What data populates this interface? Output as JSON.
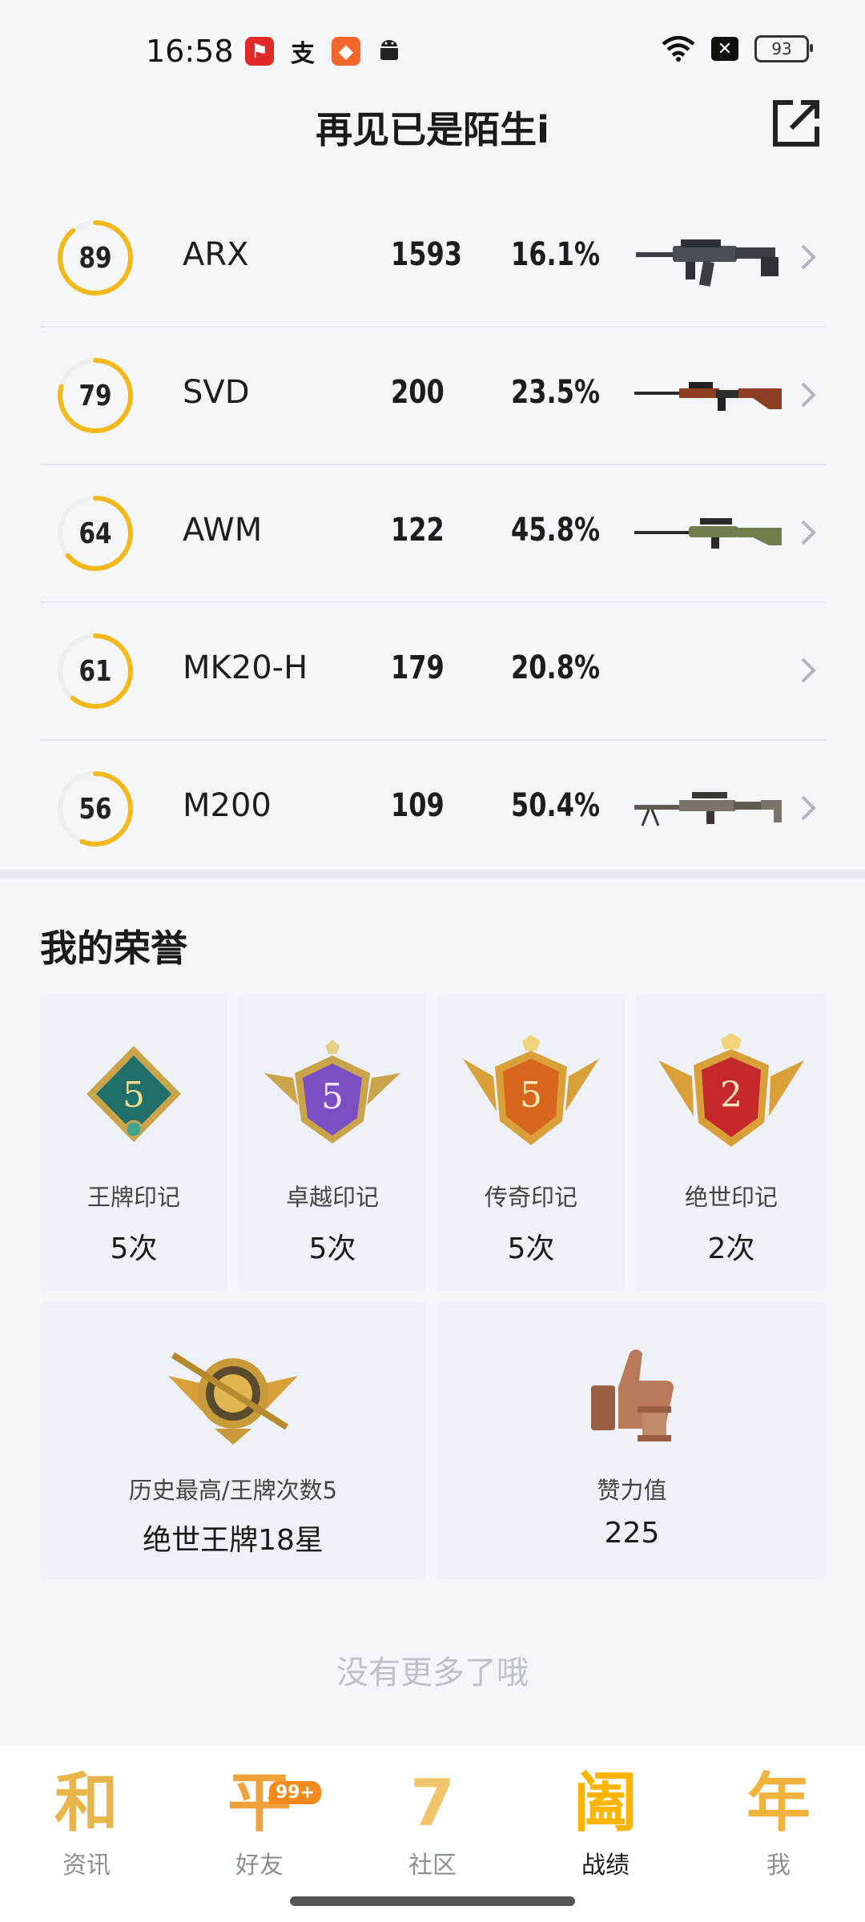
{
  "status_bar": {
    "time": "16:58",
    "battery": "93",
    "icons": [
      "notification-app-icon",
      "alipay-icon",
      "game-app-icon",
      "android-icon",
      "wifi-icon",
      "xbox-icon",
      "battery-icon"
    ]
  },
  "header": {
    "title": "再见已是陌生i",
    "share_icon": "share-icon"
  },
  "weapons": [
    {
      "score": "89",
      "score_value": 89,
      "name": "ARX",
      "kills": "1593",
      "rate": "16.1%",
      "has_image": true
    },
    {
      "score": "79",
      "score_value": 79,
      "name": "SVD",
      "kills": "200",
      "rate": "23.5%",
      "has_image": true
    },
    {
      "score": "64",
      "score_value": 64,
      "name": "AWM",
      "kills": "122",
      "rate": "45.8%",
      "has_image": true
    },
    {
      "score": "61",
      "score_value": 61,
      "name": "MK20-H",
      "kills": "179",
      "rate": "20.8%",
      "has_image": false
    },
    {
      "score": "56",
      "score_value": 56,
      "name": "M200",
      "kills": "109",
      "rate": "50.4%",
      "has_image": true
    }
  ],
  "honors": {
    "title": "我的荣誉",
    "marks": [
      {
        "label": "王牌印记",
        "value": "5次",
        "badge_number": "5",
        "icon": "ace-mark-icon",
        "color": "#1f6f6a"
      },
      {
        "label": "卓越印记",
        "value": "5次",
        "badge_number": "5",
        "icon": "excellence-mark-icon",
        "color": "#7b4fc4"
      },
      {
        "label": "传奇印记",
        "value": "5次",
        "badge_number": "5",
        "icon": "legend-mark-icon",
        "color": "#d8651c"
      },
      {
        "label": "绝世印记",
        "value": "2次",
        "badge_number": "2",
        "icon": "peerless-mark-icon",
        "color": "#c4282b"
      }
    ],
    "highest": {
      "label": "历史最高/王牌次数5",
      "value": "绝世王牌18星",
      "icon": "highest-rank-icon"
    },
    "likes": {
      "label": "赞力值",
      "value": "225",
      "icon": "thumbs-up-icon"
    }
  },
  "footer_text": "没有更多了哦",
  "nav": {
    "items": [
      {
        "glyph": "和",
        "label": "资讯",
        "icon": "news-icon"
      },
      {
        "glyph": "平",
        "label": "好友",
        "icon": "friends-icon",
        "badge": "99+"
      },
      {
        "glyph": "7",
        "label": "社区",
        "icon": "community-icon"
      },
      {
        "glyph": "阖",
        "label": "战绩",
        "icon": "record-icon",
        "active": true
      },
      {
        "glyph": "年",
        "label": "我",
        "icon": "me-icon"
      }
    ]
  },
  "colors": {
    "ring": "#f3b81a",
    "nav_gold": "#f0b43c",
    "nav_active": "#ffb400"
  }
}
